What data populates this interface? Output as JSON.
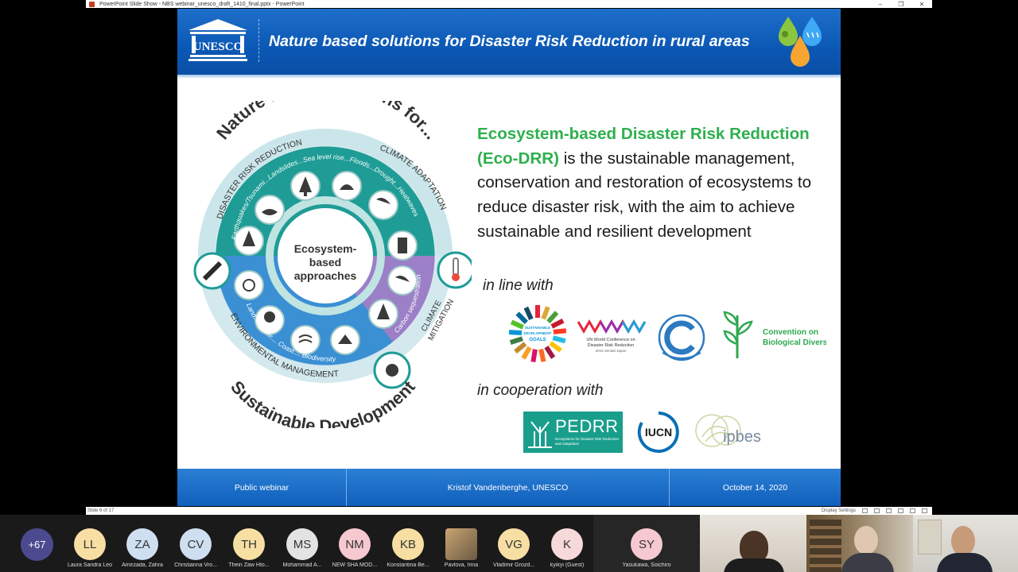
{
  "window": {
    "title": "PowerPoint Slide Show  -  NBS webinar_unesco_draft_1410_final.pptx  -  PowerPoint",
    "controls": [
      "–",
      "❐",
      "✕"
    ]
  },
  "slide": {
    "org_logo_text": "UNESCO",
    "title": "Nature based solutions for Disaster Risk Reduction in rural areas",
    "wheel": {
      "arc_top": "Nature-based solutions for...",
      "arc_bottom": "Sustainable Development",
      "center": [
        "Ecosystem-",
        "based",
        "approaches"
      ],
      "ring_drr": "DISASTER RISK REDUCTION",
      "ring_cca": "CLIMATE ADAPTATION",
      "ring_env": "ENVIRONMENTAL MANAGEMENT",
      "ring_ccm": [
        "CLIMATE",
        "MITIGATION"
      ],
      "hazards": "Earthquakes/Tsunami...Landslides...Sea level rise...Floods...Drought...Heatwaves",
      "carbon": "Carbon sequestration",
      "env_items": "Land.... Water.... Coast.... Biodiversity"
    },
    "description": {
      "term": "Ecosystem-based Disaster Risk Reduction (Eco-DRR)",
      "body": " is the sustainable management, conservation and restoration of ecosystems to reduce disaster risk, with the aim to achieve sustainable and resilient development"
    },
    "in_line_with": "in line with",
    "in_cooperation_with": "in cooperation with",
    "logos": {
      "sdg": [
        "SUSTAINABLE",
        "DEVELOPMENT",
        "GOALS"
      ],
      "wcdrr": [
        "UN World Conference on",
        "Disaster Risk Reduction",
        "2015 Sendai Japan"
      ],
      "cbd": [
        "Convention on",
        "Biological Diversity"
      ],
      "pedrr": "PEDRR",
      "pedrr_sub": "Ecosystems for Disaster Risk Reduction and Adaptation",
      "iucn": "IUCN",
      "ipbes": "ipbes"
    },
    "footer": {
      "left": "Public webinar",
      "center": "Kristof Vandenberghe, UNESCO",
      "right": "October 14, 2020"
    }
  },
  "statusbar": {
    "slide_counter": "Slide 6 of 17",
    "display_settings": "Display Settings"
  },
  "meeting": {
    "more_count": "+67",
    "participants": [
      {
        "initials": "LL",
        "name": "Laura Sandra Leo",
        "color": "#f7dfa4"
      },
      {
        "initials": "ZA",
        "name": "Amirzada, Zahra",
        "color": "#cfdff2"
      },
      {
        "initials": "CV",
        "name": "Christianna Vro...",
        "color": "#cfdff2"
      },
      {
        "initials": "TH",
        "name": "Thein Zaw Hto...",
        "color": "#f7dfa4"
      },
      {
        "initials": "MS",
        "name": "Mohammad A...",
        "color": "#e3e3e3"
      },
      {
        "initials": "NM",
        "name": "NEW SHA MOD...",
        "color": "#f6c8d0"
      },
      {
        "initials": "KB",
        "name": "Konstantina Be...",
        "color": "#f7dfa4"
      },
      {
        "initials": "",
        "name": "Pavlova, Irina",
        "color": "#caa472"
      },
      {
        "initials": "VG",
        "name": "Vladimir Grozd...",
        "color": "#f7dfa4"
      },
      {
        "initials": "K",
        "name": "kyikyi (Guest)",
        "color": "#f6d9d9"
      },
      {
        "initials": "SY",
        "name": "Yasukawa, Soichiro",
        "color": "#f6c8d0"
      }
    ]
  }
}
